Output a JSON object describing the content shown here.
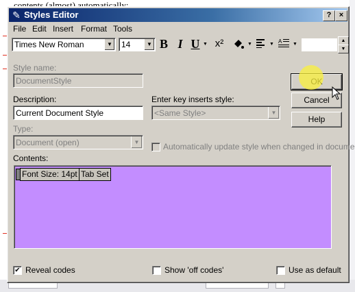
{
  "background_doc": {
    "text": "contents (almost) automatically:"
  },
  "dialog": {
    "title": "Styles Editor",
    "title_buttons": {
      "help": "?",
      "close": "×"
    },
    "menu": [
      {
        "label": "File"
      },
      {
        "label": "Edit"
      },
      {
        "label": "Insert"
      },
      {
        "label": "Format"
      },
      {
        "label": "Tools"
      }
    ],
    "toolbar": {
      "font_name": "Times New Roman",
      "font_size": "14",
      "bold": "B",
      "italic": "I",
      "underline": "U",
      "superscript": "x²"
    },
    "style_name": {
      "label": "Style name:",
      "value": "DocumentStyle"
    },
    "description": {
      "label": "Description:",
      "value": "Current Document Style"
    },
    "enter_key": {
      "label": "Enter key inserts style:",
      "value": "<Same Style>"
    },
    "type": {
      "label": "Type:",
      "value": "Document (open)"
    },
    "auto_update": {
      "label": "Automatically update style when changed in document",
      "checked": false
    },
    "contents": {
      "label": "Contents:",
      "codes": [
        "Font Size: 14pt",
        "Tab Set"
      ],
      "background_color": "#c38dff"
    },
    "buttons": {
      "ok": "OK",
      "cancel": "Cancel",
      "help": "Help"
    },
    "reveal_codes": {
      "label": "Reveal codes",
      "checked": true
    },
    "show_off_codes": {
      "label": "Show 'off codes'",
      "checked": false
    },
    "use_as_default": {
      "label": "Use as default",
      "checked": false
    }
  }
}
